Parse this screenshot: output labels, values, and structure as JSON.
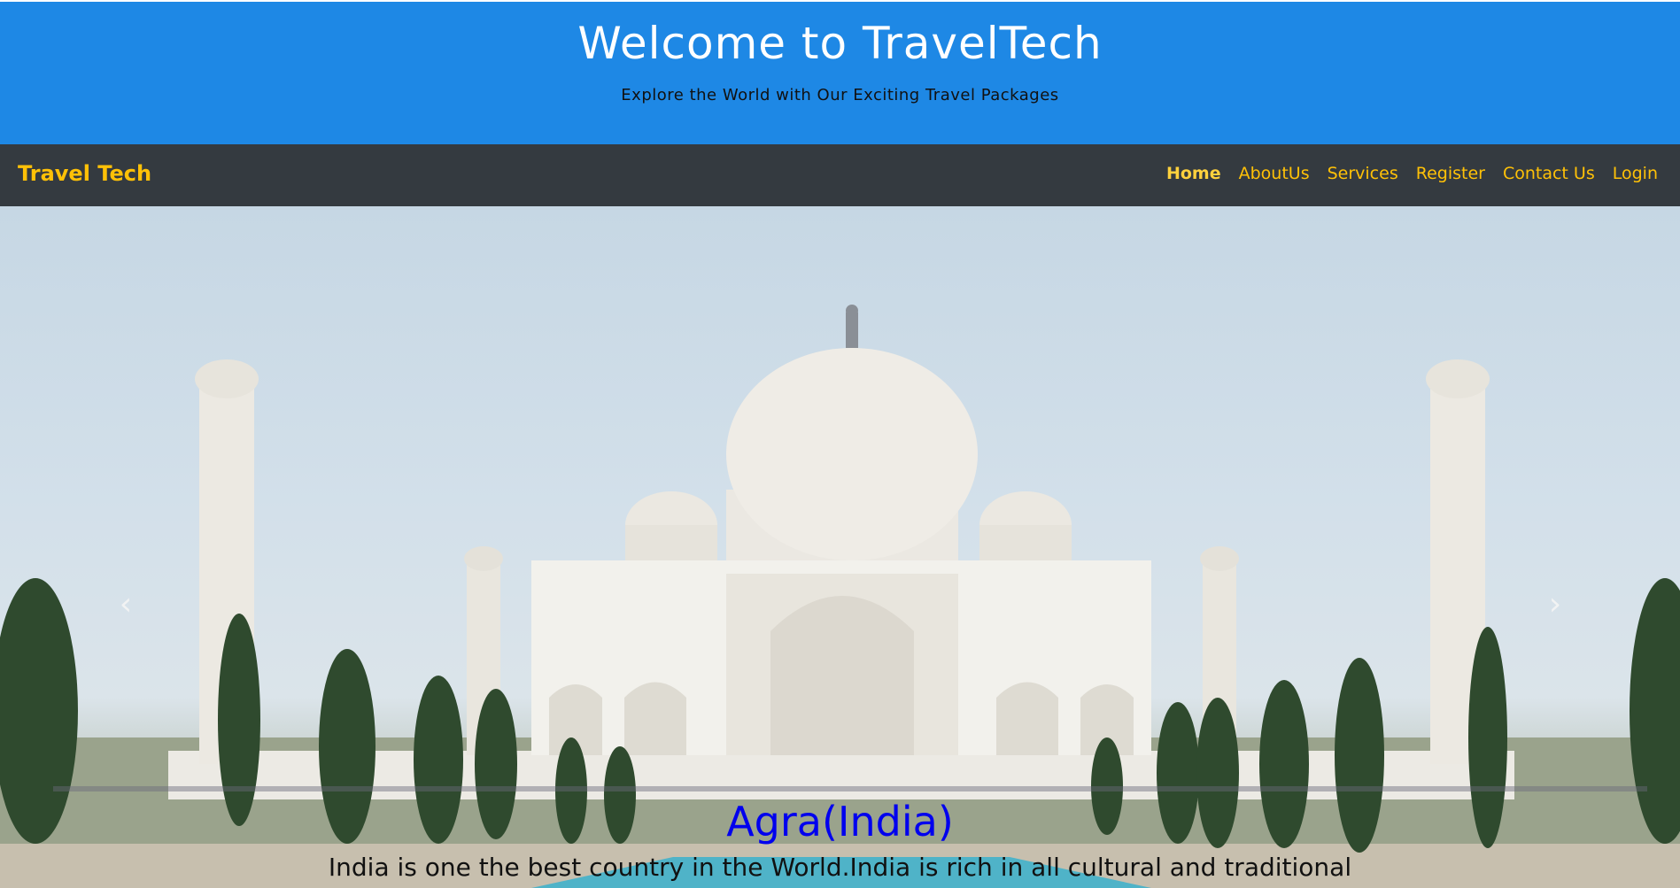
{
  "header": {
    "title": "Welcome to TravelTech",
    "subtitle": "Explore the World with Our Exciting Travel Packages"
  },
  "navbar": {
    "brand": "Travel Tech",
    "links": [
      {
        "label": "Home",
        "active": true
      },
      {
        "label": "AboutUs"
      },
      {
        "label": "Services"
      },
      {
        "label": "Register"
      },
      {
        "label": "Contact Us"
      },
      {
        "label": "Login"
      }
    ]
  },
  "carousel": {
    "prev_icon": "chevron-left-icon",
    "next_icon": "chevron-right-icon",
    "slide": {
      "image": "taj-mahal-photo",
      "caption_title": "Agra(India)",
      "caption_text": "India is one the best country in the World.India is rich in all cultural and traditional"
    }
  },
  "colors": {
    "banner": "#1e88e5",
    "navbar": "#343a40",
    "nav_text": "#ffc107",
    "caption_title": "#0000ee"
  }
}
